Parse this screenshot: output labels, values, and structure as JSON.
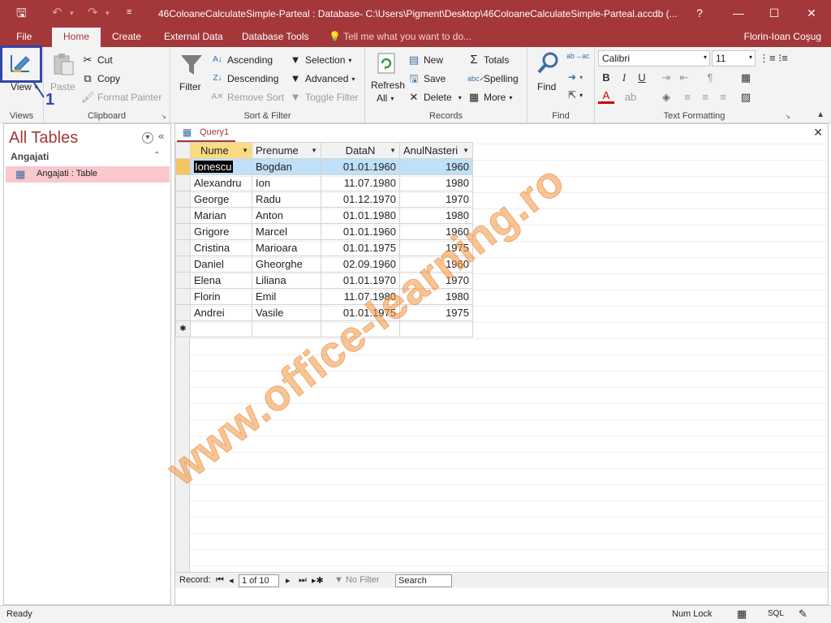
{
  "title_bar": {
    "title": "46ColoaneCalculateSimple-Parteal : Database- C:\\Users\\Pigment\\Desktop\\46ColoaneCalculateSimple-Parteal.accdb (...",
    "help": "?",
    "minimize": "—",
    "restore": "☐",
    "close": "✕"
  },
  "tabs": [
    "File",
    "Home",
    "Create",
    "External Data",
    "Database Tools"
  ],
  "tell_me": "Tell me what you want to do...",
  "user": "Florin-Ioan Coşug",
  "ribbon": {
    "views": {
      "view": "View",
      "label": "Views"
    },
    "clipboard": {
      "paste": "Paste",
      "cut": "Cut",
      "copy": "Copy",
      "format_painter": "Format Painter",
      "label": "Clipboard"
    },
    "sort_filter": {
      "filter": "Filter",
      "ascending": "Ascending",
      "descending": "Descending",
      "remove_sort": "Remove Sort",
      "selection": "Selection",
      "advanced": "Advanced",
      "toggle_filter": "Toggle Filter",
      "label": "Sort & Filter"
    },
    "records": {
      "refresh": "Refresh",
      "refresh2": "All",
      "new": "New",
      "save": "Save",
      "delete": "Delete",
      "totals": "Totals",
      "spelling": "Spelling",
      "more": "More",
      "label": "Records"
    },
    "find": {
      "find": "Find",
      "label": "Find"
    },
    "text_formatting": {
      "font": "Calibri",
      "size": "11",
      "bold": "B",
      "italic": "I",
      "underline": "U",
      "label": "Text Formatting"
    }
  },
  "nav": {
    "title": "All Tables",
    "group": "Angajati",
    "item": "Angajati : Table"
  },
  "document": {
    "tab": "Query1",
    "close": "✕",
    "columns": [
      "Nume",
      "Prenume",
      "DataN",
      "AnulNasteri"
    ],
    "rows": [
      [
        "Ionescu",
        "Bogdan",
        "01.01.1960",
        "1960"
      ],
      [
        "Alexandru",
        "Ion",
        "11.07.1980",
        "1980"
      ],
      [
        "George",
        "Radu",
        "01.12.1970",
        "1970"
      ],
      [
        "Marian",
        "Anton",
        "01.01.1980",
        "1980"
      ],
      [
        "Grigore",
        "Marcel",
        "01.01.1960",
        "1960"
      ],
      [
        "Cristina",
        "Marioara",
        "01.01.1975",
        "1975"
      ],
      [
        "Daniel",
        "Gheorghe",
        "02.09.1960",
        "1960"
      ],
      [
        "Elena",
        "Liliana",
        "01.01.1970",
        "1970"
      ],
      [
        "Florin",
        "Emil",
        "11.07.1980",
        "1980"
      ],
      [
        "Andrei",
        "Vasile",
        "01.01.1975",
        "1975"
      ]
    ],
    "new_row_marker": "✱",
    "record_nav": {
      "label": "Record:",
      "position": "1 of 10",
      "no_filter": "No Filter",
      "search": "Search"
    }
  },
  "status": {
    "ready": "Ready",
    "num_lock": "Num Lock",
    "sql": "SQL"
  },
  "annotation": {
    "step": "1"
  },
  "watermark": "www.office-learning.ro",
  "colors": {
    "accent": "#a4373a",
    "highlight": "#3046a8",
    "selected_row": "#bfe0f7",
    "active_header": "#fadb82",
    "nav_item": "#f8c8cc"
  }
}
